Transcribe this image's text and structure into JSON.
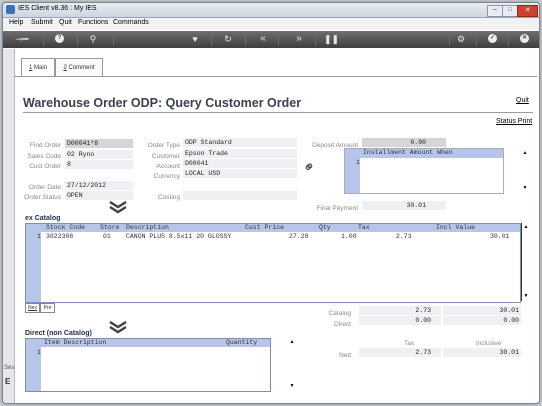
{
  "window": {
    "title": "IES Client v8.36 : My IES"
  },
  "menu": [
    "Help",
    "Submit",
    "Quit",
    "Functions",
    "Commands"
  ],
  "toolbar": {
    "info_label": "?",
    "back_label": "«",
    "forward_label": "»"
  },
  "tabs": [
    {
      "key": "1",
      "label": "Main"
    },
    {
      "key": "2",
      "label": "Comment"
    }
  ],
  "page": {
    "title": "Warehouse Order ODP: Query Customer Order",
    "quit_link": "Quit",
    "status_link": "Status Print"
  },
  "header_left": {
    "find_order_label": "Find Order",
    "find_order": "D00041*8",
    "sales_code_label": "Sales Code",
    "sales_code": "02 Ryno",
    "cust_order_label": "Cust Order",
    "cust_order": "8",
    "order_date_label": "Order Date",
    "order_date": "27/12/2012",
    "order_status_label": "Order Status",
    "order_status": "OPEN"
  },
  "header_mid": {
    "order_type_label": "Order Type",
    "order_type": "ODP Standard",
    "customer_label": "Customer",
    "customer": "Epson Trade",
    "account_label": "Account",
    "account": "D00041",
    "currency_label": "Currency",
    "currency": "LOCAL USD",
    "costing_label": "Costing"
  },
  "deposit": {
    "deposit_label": "Deposit Amount",
    "deposit_value": "0.00",
    "installment_header": "Installment Amount When",
    "installment_row": "1",
    "final_payment_label": "Final Payment",
    "final_payment": "30.01"
  },
  "ex_catalog": {
    "heading": "ex Catalog",
    "columns": [
      "Stock Code",
      "Store",
      "Description",
      "Cust Price",
      "Qty",
      "Tax",
      "Incl Value"
    ],
    "rows": [
      {
        "n": "1",
        "stock_code": "3022306",
        "store": "01",
        "description": "CANON PLUS 8.5x11 20 GLOSSY",
        "cust_price": "27.28",
        "qty": "1.00",
        "tax": "2.73",
        "incl_value": "30.01"
      }
    ],
    "nav_next": "Nex",
    "nav_prev": "Pre"
  },
  "totals": {
    "catalog_label": "Catalog",
    "catalog_tax": "2.73",
    "catalog_incl": "30.01",
    "direct_label": "Direct",
    "direct_tax": "0.00",
    "direct_incl": "0.00",
    "tax_header": "Tax",
    "inclusive_header": "Inclusive",
    "nett_label": "Nett",
    "nett_tax": "2.73",
    "nett_incl": "30.01"
  },
  "direct": {
    "heading": "Direct (non Catalog)",
    "columns": [
      "Item Description",
      "Quantity"
    ],
    "row_num": "1"
  },
  "side": {
    "fragment": "Ses"
  },
  "colors": {
    "accent": "#1f2d4a",
    "grid_header": "#b7c5e8",
    "toolbar": "#4a4a4a"
  }
}
